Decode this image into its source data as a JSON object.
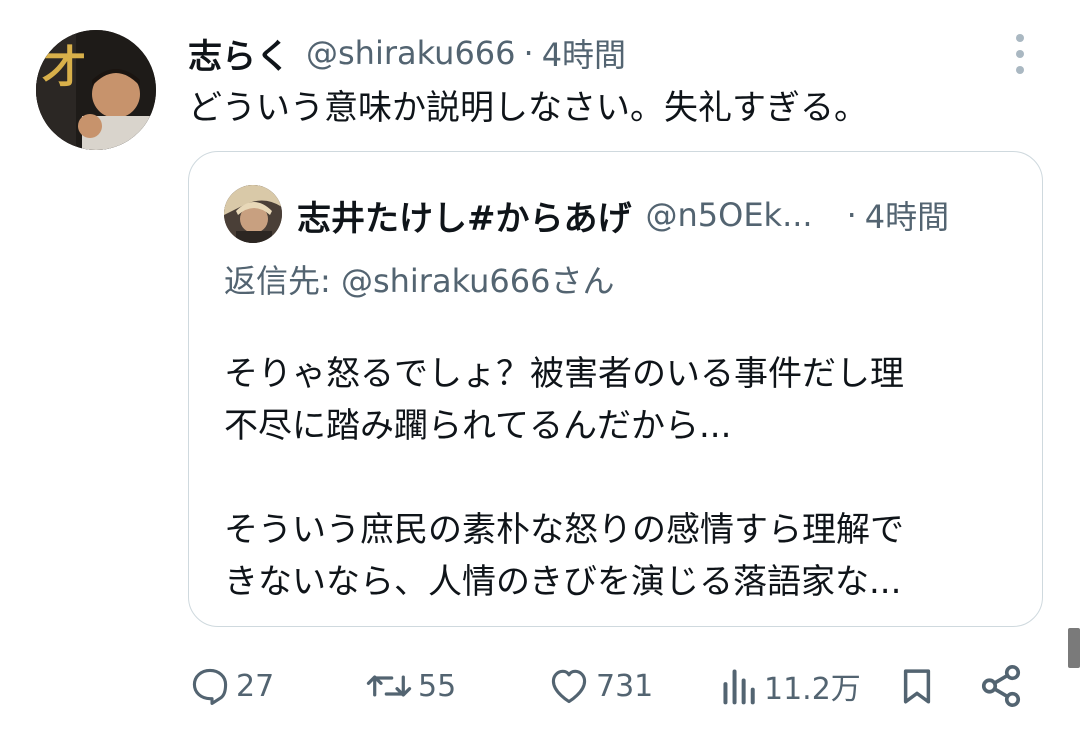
{
  "tweet": {
    "display_name": "志らく",
    "handle": "@shiraku666",
    "separator": "·",
    "time": "4時間",
    "text": "どういう意味か説明しなさい。失礼すぎる。",
    "avatar_icon": "user-avatar",
    "more_icon": "more-vertical-icon"
  },
  "quote": {
    "display_name": "志井たけし#からあげ",
    "handle": "@n5OEk...",
    "separator": "·",
    "time": "4時間",
    "reply_to": "返信先: @shiraku666さん",
    "para1_line1": "そりゃ怒るでしょ？被害者のいる事件だし理",
    "para1_line2": "不尽に踏み躙られてるんだから...",
    "para2_line1": "そういう庶民の素朴な怒りの感情すら理解で",
    "para2_line2": "きないなら、人情のきびを演じる落語家な..."
  },
  "actions": {
    "reply_count": "27",
    "retweet_count": "55",
    "like_count": "731",
    "views_count": "11.2万",
    "icons": [
      "reply-icon",
      "retweet-icon",
      "like-icon",
      "views-icon",
      "bookmark-icon",
      "share-icon"
    ]
  },
  "colors": {
    "text_primary": "#0f1419",
    "text_secondary": "#536471",
    "border": "#cfd9de"
  }
}
